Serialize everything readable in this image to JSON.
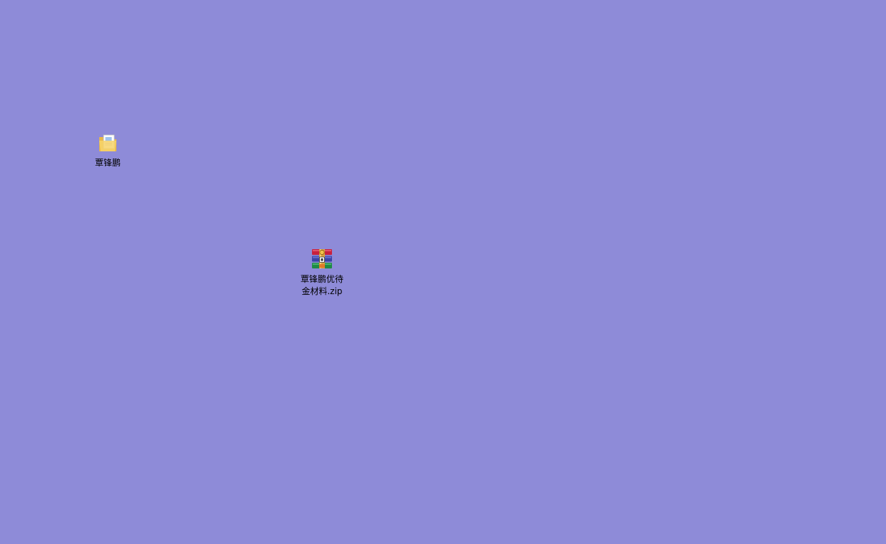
{
  "desktop": {
    "background_color": "#8e8bd8",
    "items": [
      {
        "type": "folder",
        "icon": "folder-with-document-icon",
        "label": "覃锋鹏"
      },
      {
        "type": "zip-archive",
        "icon": "winrar-archive-icon",
        "label_lines": [
          "覃锋鹏优待",
          "金材料.zip"
        ]
      }
    ]
  }
}
